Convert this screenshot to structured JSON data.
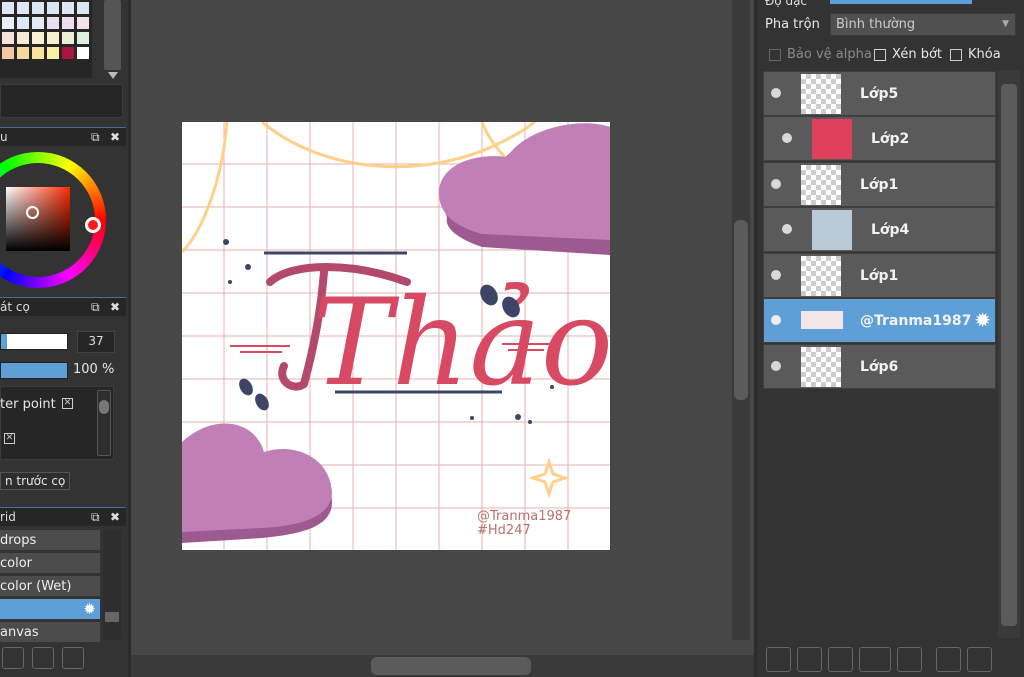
{
  "left_panel": {
    "color_wheel_title": "u",
    "brush_size_title": "át cọ",
    "brush_size_value": "37",
    "opacity_value": "100 %",
    "opacity_level": 1.0,
    "center_point_label": "ter point",
    "brush_preview_button": "n trước cọ",
    "brush_list_title": "rid",
    "brush_items": [
      {
        "label": "drops"
      },
      {
        "label": "color"
      },
      {
        "label": "color (Wet)"
      },
      {
        "label": ""
      },
      {
        "label": "anvas"
      }
    ]
  },
  "artwork": {
    "title_text": "Thảo",
    "signature_line1": "@Tranma1987",
    "signature_line2": "#Hd247"
  },
  "right_panel": {
    "top_label_partial": "Độ đặc",
    "blend_label": "Pha trộn",
    "blend_value": "Bình thường",
    "protect_alpha": "Bảo vệ alpha",
    "clipping": "Xén bớt",
    "lock": "Khóa",
    "layers": [
      {
        "name": "Lớp5",
        "selected": false
      },
      {
        "name": "Lớp2",
        "selected": false
      },
      {
        "name": "Lớp1",
        "selected": false
      },
      {
        "name": "Lớp4",
        "selected": false
      },
      {
        "name": "Lớp1",
        "selected": false
      },
      {
        "name": "@Tranma1987",
        "selected": true
      },
      {
        "name": "Lớp6",
        "selected": false
      }
    ]
  },
  "colors": {
    "accent": "#5d9fd6",
    "panel": "#333333",
    "canvas_bg": "#474747",
    "title_red": "#d84a63",
    "heart_purple": "#c07fb6",
    "navy": "#3d4466",
    "yellow": "#ffd089"
  }
}
